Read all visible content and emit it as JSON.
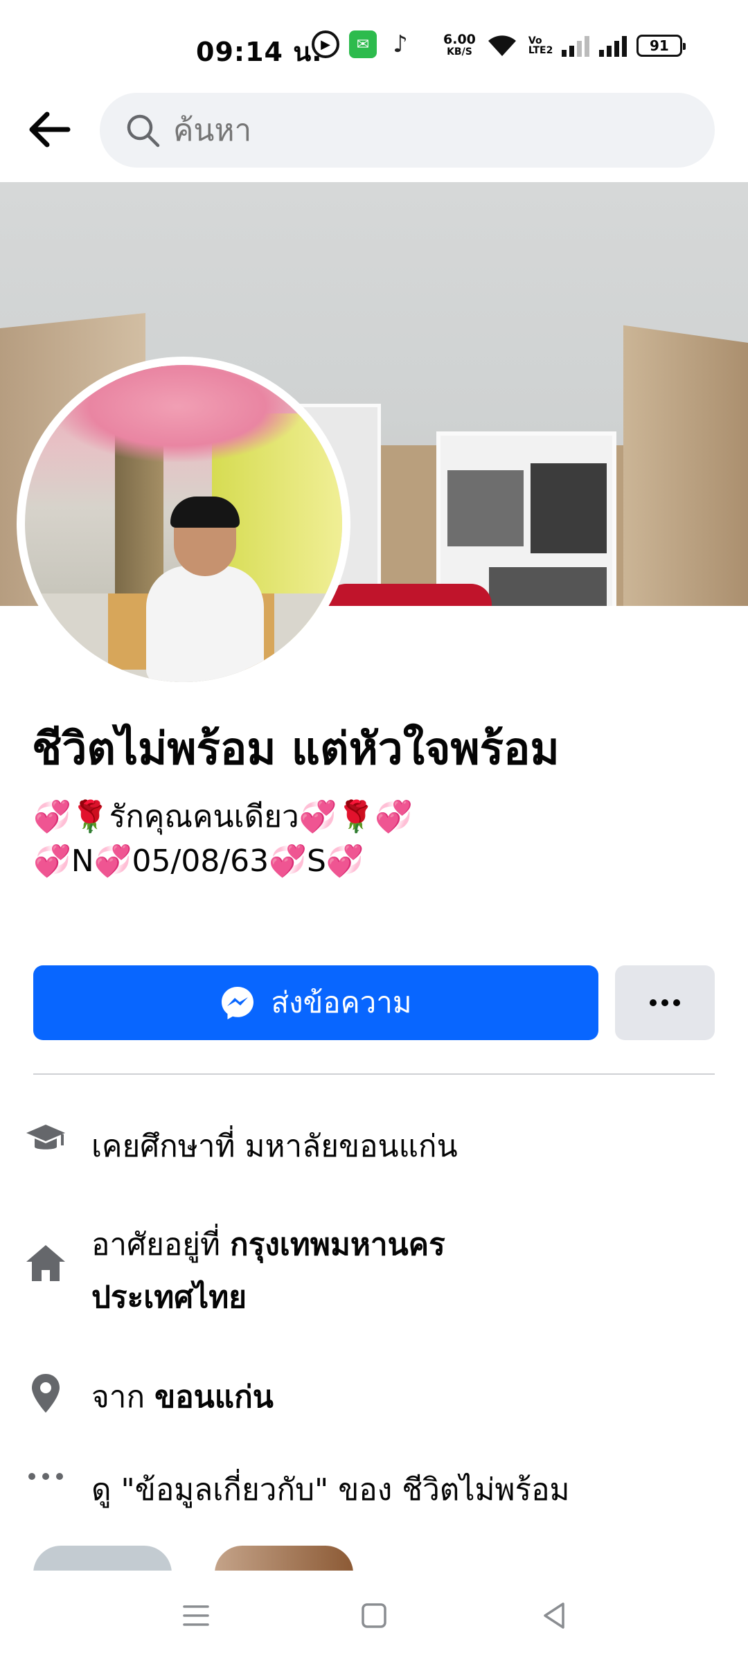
{
  "status_bar": {
    "time": "09:14 น.",
    "speed_value": "6.00",
    "speed_unit": "KB/S",
    "volte": "Vo LTE2",
    "battery": "91"
  },
  "header": {
    "search_placeholder": "ค้นหา"
  },
  "profile": {
    "name": "ชีวิตไม่พร้อม แต่หัวใจพร้อม",
    "bio_line1_text": "รักคุณคนเดียว",
    "bio_line2_a": "N",
    "bio_line2_b": "05/08/63",
    "bio_line2_c": "S"
  },
  "actions": {
    "message_label": "ส่งข้อความ"
  },
  "info": {
    "education": "เคยศึกษาที่ มหาลัยขอนแก่น",
    "lives_prefix": "อาศัยอยู่ที่ ",
    "lives_city": "กรุงเทพมหานคร",
    "lives_country": "ประเทศไทย",
    "from_prefix": "จาก ",
    "from_place": "ขอนแก่น",
    "about_link": "ดู \"ข้อมูลเกี่ยวกับ\" ของ ชีวิตไม่พร้อม"
  },
  "colors": {
    "accent": "#0866ff",
    "secondary_button": "#e4e6eb",
    "search_bg": "#f0f2f5"
  }
}
